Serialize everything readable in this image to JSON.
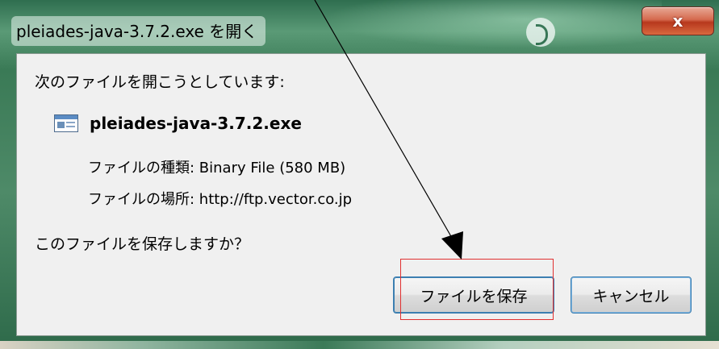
{
  "window": {
    "title": "pleiades-java-3.7.2.exe を開く",
    "close_label": "x"
  },
  "dialog": {
    "prompt": "次のファイルを開こうとしています:",
    "file_name": "pleiades-java-3.7.2.exe",
    "type_row": "ファイルの種類: Binary File (580 MB)",
    "location_row": "ファイルの場所: http://ftp.vector.co.jp",
    "question": "このファイルを保存しますか？",
    "save_label": "ファイルを保存",
    "cancel_label": "キャンセル"
  },
  "annotation": {
    "highlight_color": "#e03030",
    "arrow_color": "#000000"
  },
  "icons": {
    "file": "executable-file-icon",
    "close": "close-icon"
  }
}
